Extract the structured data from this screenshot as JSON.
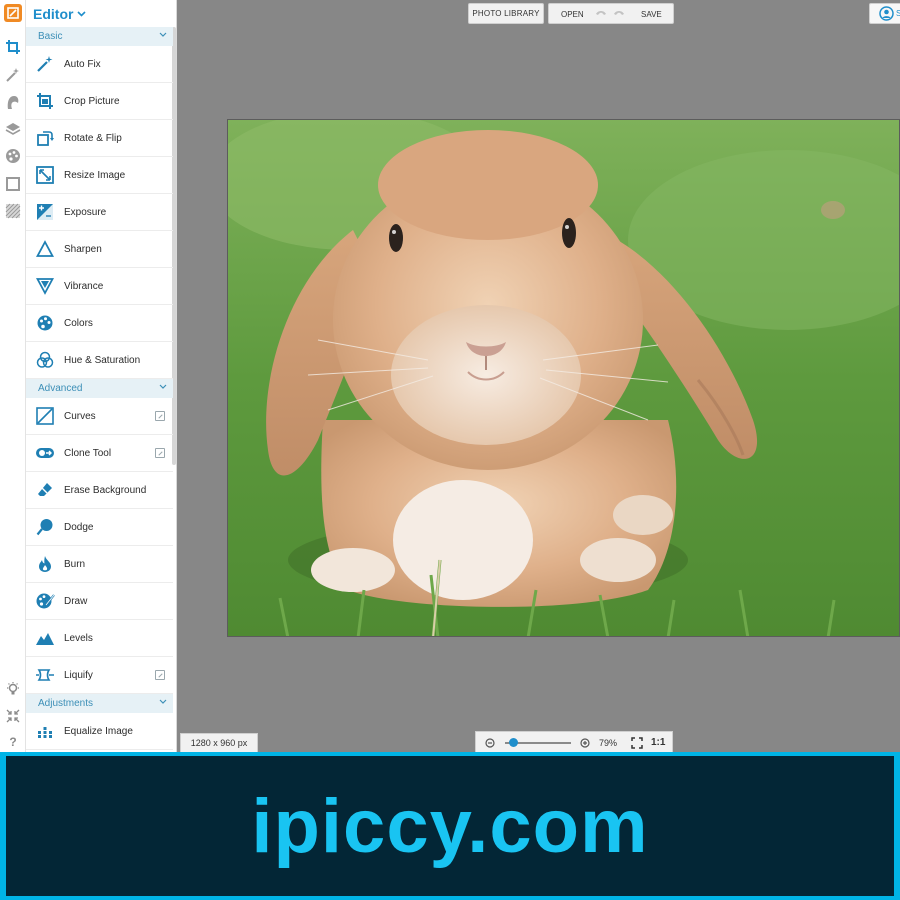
{
  "editor": {
    "title": "Editor",
    "sections": {
      "basic": "Basic",
      "advanced": "Advanced",
      "adjustments": "Adjustments"
    },
    "basic_tools": [
      "Auto Fix",
      "Crop Picture",
      "Rotate & Flip",
      "Resize Image",
      "Exposure",
      "Sharpen",
      "Vibrance",
      "Colors",
      "Hue & Saturation"
    ],
    "advanced_tools": [
      "Curves",
      "Clone Tool",
      "Erase Background",
      "Dodge",
      "Burn",
      "Draw",
      "Levels",
      "Liquify"
    ],
    "adjustment_tools": [
      "Equalize Image"
    ]
  },
  "toolbar": {
    "photo_library": "PHOTO LIBRARY",
    "open": "OPEN",
    "save": "SAVE",
    "account_label": "S"
  },
  "status": {
    "dimensions": "1280 x 960 px",
    "zoom_percent": "79%",
    "zoom_fraction": 0.1,
    "actual_size": "1:1"
  },
  "rail_icons": [
    "crop-icon",
    "magic-wand-icon",
    "face-icon",
    "layers-icon",
    "palette-icon",
    "frame-icon",
    "texture-icon",
    "lightbulb-icon",
    "collapse-icon",
    "help-icon"
  ],
  "banner": {
    "text": "ipiccy.com"
  },
  "colors": {
    "accent": "#1f8ecb",
    "logo": "#f08a24",
    "workspace": "#878787",
    "banner_border": "#00b4e6",
    "banner_bg": "#032636",
    "banner_text": "#19c4f2"
  }
}
